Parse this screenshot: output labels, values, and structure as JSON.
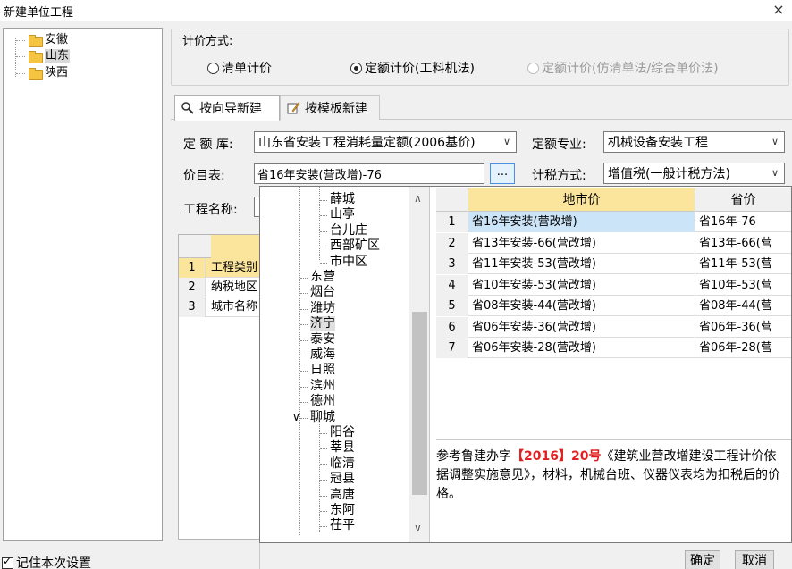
{
  "window": {
    "title": "新建单位工程",
    "close": "×"
  },
  "left_tree": {
    "items": [
      {
        "label": "安徽",
        "selected": false
      },
      {
        "label": "山东",
        "selected": true
      },
      {
        "label": "陕西",
        "selected": false
      }
    ]
  },
  "pricing": {
    "legend": "计价方式:",
    "options": [
      {
        "label": "清单计价",
        "checked": false,
        "disabled": false
      },
      {
        "label": "定额计价(工料机法)",
        "checked": true,
        "disabled": false
      },
      {
        "label": "定额计价(仿清单法/综合单价法)",
        "checked": false,
        "disabled": true
      }
    ]
  },
  "tabs": [
    {
      "label": "按向导新建",
      "active": true
    },
    {
      "label": "按模板新建",
      "active": false
    }
  ],
  "form": {
    "quota_lib_label": "定 额 库:",
    "quota_lib_value": "山东省安装工程消耗量定额(2006基价)",
    "specialty_label": "定额专业:",
    "specialty_value": "机械设备安装工程",
    "price_list_label": "价目表:",
    "price_list_value": "省16年安装(营改增)-76",
    "browse": "...",
    "tax_label": "计税方式:",
    "tax_value": "增值税(一般计税方法)",
    "project_name_label": "工程名称:"
  },
  "bg_grid": {
    "rows": [
      {
        "num": "1",
        "text": "工程类别",
        "selected": true
      },
      {
        "num": "2",
        "text": "纳税地区",
        "selected": false
      },
      {
        "num": "3",
        "text": "城市名称",
        "selected": false
      }
    ]
  },
  "popup": {
    "tree": [
      {
        "label": "薛城",
        "level": 2
      },
      {
        "label": "山亭",
        "level": 2
      },
      {
        "label": "台儿庄",
        "level": 2
      },
      {
        "label": "西部矿区",
        "level": 2
      },
      {
        "label": "市中区",
        "level": 2
      },
      {
        "label": "东营",
        "level": 1
      },
      {
        "label": "烟台",
        "level": 1
      },
      {
        "label": "潍坊",
        "level": 1
      },
      {
        "label": "济宁",
        "level": 1,
        "selected": true
      },
      {
        "label": "泰安",
        "level": 1
      },
      {
        "label": "威海",
        "level": 1
      },
      {
        "label": "日照",
        "level": 1
      },
      {
        "label": "滨州",
        "level": 1
      },
      {
        "label": "德州",
        "level": 1
      },
      {
        "label": "聊城",
        "level": 1,
        "expanded": true
      },
      {
        "label": "阳谷",
        "level": 2
      },
      {
        "label": "莘县",
        "level": 2
      },
      {
        "label": "临清",
        "level": 2
      },
      {
        "label": "冠县",
        "level": 2
      },
      {
        "label": "高唐",
        "level": 2
      },
      {
        "label": "东阿",
        "level": 2
      },
      {
        "label": "茌平",
        "level": 2
      }
    ],
    "expand_glyph": "∨",
    "grid": {
      "col_city": "地市价",
      "col_prov": "省价",
      "rows": [
        {
          "n": "1",
          "city": "省16年安装(营改增)",
          "prov": "省16年-76",
          "selected": true
        },
        {
          "n": "2",
          "city": "省13年安装-66(营改增)",
          "prov": "省13年-66(营",
          "selected": false
        },
        {
          "n": "3",
          "city": "省11年安装-53(营改增)",
          "prov": "省11年-53(营",
          "selected": false
        },
        {
          "n": "4",
          "city": "省10年安装-53(营改增)",
          "prov": "省10年-53(营",
          "selected": false
        },
        {
          "n": "5",
          "city": "省08年安装-44(营改增)",
          "prov": "省08年-44(营",
          "selected": false
        },
        {
          "n": "6",
          "city": "省06年安装-36(营改增)",
          "prov": "省06年-36(营",
          "selected": false
        },
        {
          "n": "7",
          "city": "省06年安装-28(营改增)",
          "prov": "省06年-28(营",
          "selected": false
        }
      ]
    },
    "note": {
      "prefix": "参考鲁建办字",
      "highlight": "【2016】20号",
      "suffix": "《建筑业营改增建设工程计价依据调整实施意见》，材料，机械台班、仪器仪表均为扣税后的价格。"
    }
  },
  "footer": {
    "remember": "记住本次设置",
    "ok": "确定",
    "cancel": "取消"
  }
}
